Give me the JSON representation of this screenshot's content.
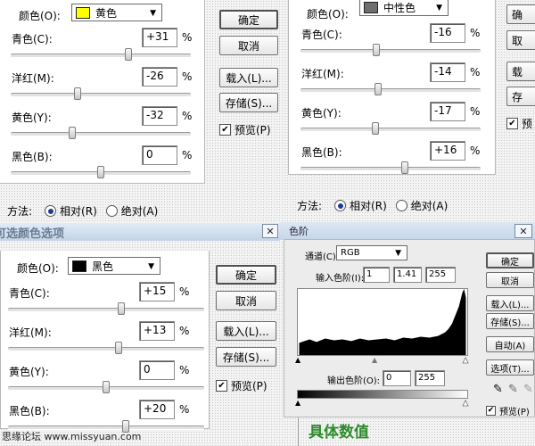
{
  "dialogs": {
    "yellow": {
      "color_label": "颜色(O):",
      "color_value": "黄色",
      "swatch_color": "#ffff00",
      "sliders": [
        {
          "label": "青色(C):",
          "value": "+31",
          "unit": "%",
          "level": 0.655
        },
        {
          "label": "洋红(M):",
          "value": "-26",
          "unit": "%",
          "level": 0.37
        },
        {
          "label": "黄色(Y):",
          "value": "-32",
          "unit": "%",
          "level": 0.34
        },
        {
          "label": "黑色(B):",
          "value": "0",
          "unit": "%",
          "level": 0.5
        }
      ],
      "buttons": {
        "ok": "确定",
        "cancel": "取消",
        "load": "载入(L)...",
        "save": "存储(S)..."
      },
      "preview_label": "预览(P)",
      "method_label": "方法:",
      "relative_label": "相对(R)",
      "absolute_label": "绝对(A)"
    },
    "neutral": {
      "color_label": "颜色(O):",
      "color_value": "中性色",
      "swatch_color": "#6e6e6e",
      "sliders": [
        {
          "label": "青色(C):",
          "value": "-16",
          "unit": "%",
          "level": 0.42
        },
        {
          "label": "洋红(M):",
          "value": "-14",
          "unit": "%",
          "level": 0.43
        },
        {
          "label": "黄色(Y):",
          "value": "-17",
          "unit": "%",
          "level": 0.415
        },
        {
          "label": "黑色(B):",
          "value": "+16",
          "unit": "%",
          "level": 0.58
        }
      ],
      "method_label": "方法:",
      "relative_label": "相对(R)",
      "absolute_label": "绝对(A)",
      "side_buttons": {
        "ok": "确",
        "cancel": "取",
        "load": "载",
        "save": "存",
        "preview": "预"
      }
    },
    "black": {
      "title": "可选颜色选项",
      "close": "✕",
      "color_label": "颜色(O):",
      "color_value": "黑色",
      "swatch_color": "#000000",
      "sliders": [
        {
          "label": "青色(C):",
          "value": "+15",
          "unit": "%",
          "level": 0.575
        },
        {
          "label": "洋红(M):",
          "value": "+13",
          "unit": "%",
          "level": 0.565
        },
        {
          "label": "黄色(Y):",
          "value": "0",
          "unit": "%",
          "level": 0.5
        },
        {
          "label": "黑色(B):",
          "value": "+20",
          "unit": "%",
          "level": 0.6
        }
      ],
      "buttons": {
        "ok": "确定",
        "cancel": "取消",
        "load": "载入(L)...",
        "save": "存储(S)..."
      },
      "preview_label": "预览(P)"
    },
    "levels": {
      "title": "色阶",
      "close": "✕",
      "channel_label": "通道(C):",
      "channel_value": "RGB",
      "input_label": "输入色阶(I):",
      "input_values": [
        "1",
        "1.41",
        "255"
      ],
      "output_label": "输出色阶(O):",
      "output_values": [
        "0",
        "255"
      ],
      "buttons": {
        "ok": "确定",
        "cancel": "取消",
        "load": "载入(L)...",
        "save": "存储(S)...",
        "auto": "自动(A)",
        "options": "选项(T)..."
      },
      "preview_label": "预览(P)"
    }
  },
  "footer": {
    "watermark": "思缘论坛 www.missyuan.com",
    "caption": "具体数值"
  },
  "colors": {
    "caption": "#2e8b2e",
    "titlebar_text": "#6b7d95",
    "radio_dot": "#1b3d8f"
  }
}
